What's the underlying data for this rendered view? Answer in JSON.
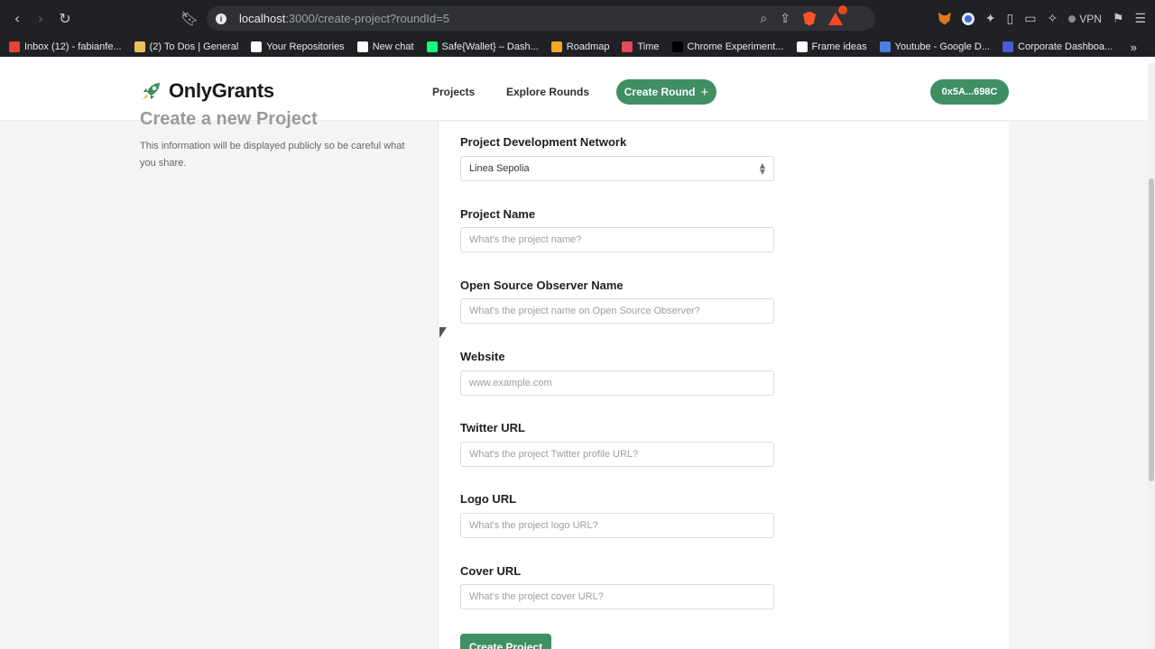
{
  "browser": {
    "url_host": "localhost",
    "url_path": ":3000/create-project?roundId=5",
    "vpn_label": "VPN",
    "bookmarks": [
      {
        "label": "Inbox (12) - fabianfe...",
        "icon": "gmail-icon",
        "color": "#ea4335"
      },
      {
        "label": "(2) To Dos | General",
        "icon": "note-icon",
        "color": "#e8c15a"
      },
      {
        "label": "Your Repositories",
        "icon": "github-icon",
        "color": "#ffffff"
      },
      {
        "label": "New chat",
        "icon": "openai-icon",
        "color": "#ffffff"
      },
      {
        "label": "Safe{Wallet} – Dash...",
        "icon": "safe-icon",
        "color": "#12ff80"
      },
      {
        "label": "Roadmap",
        "icon": "rocket-icon",
        "color": "#f5a623"
      },
      {
        "label": "Time",
        "icon": "time-icon",
        "color": "#e24b57"
      },
      {
        "label": "Chrome Experiment...",
        "icon": "e-icon",
        "color": "#000000"
      },
      {
        "label": "Frame ideas",
        "icon": "github-icon",
        "color": "#ffffff"
      },
      {
        "label": "Youtube - Google D...",
        "icon": "docs-icon",
        "color": "#4a7fe0"
      },
      {
        "label": "Corporate Dashboa...",
        "icon": "dashboard-icon",
        "color": "#4a5bd6"
      }
    ],
    "more_label": "»"
  },
  "header": {
    "logo_text": "OnlyGrants",
    "nav": [
      "Projects",
      "Explore Rounds"
    ],
    "create_round_label": "Create Round",
    "wallet_label": "0x5A...698C",
    "accent": "#3f8f63"
  },
  "page": {
    "title": "Create a new Project",
    "subtitle": "This information will be displayed publicly so be careful what you share."
  },
  "form": {
    "network_label": "Project Development Network",
    "network_value": "Linea Sepolia",
    "name_label": "Project Name",
    "name_placeholder": "What's the project name?",
    "oso_label": "Open Source Observer Name",
    "oso_placeholder": "What's the project name on Open Source Observer?",
    "website_label": "Website",
    "website_placeholder": "www.example.com",
    "twitter_label": "Twitter URL",
    "twitter_placeholder": "What's the project Twitter profile URL?",
    "logo_label": "Logo URL",
    "logo_placeholder": "What's the project logo URL?",
    "cover_label": "Cover URL",
    "cover_placeholder": "What's the project cover URL?",
    "submit_label": "Create Project"
  }
}
